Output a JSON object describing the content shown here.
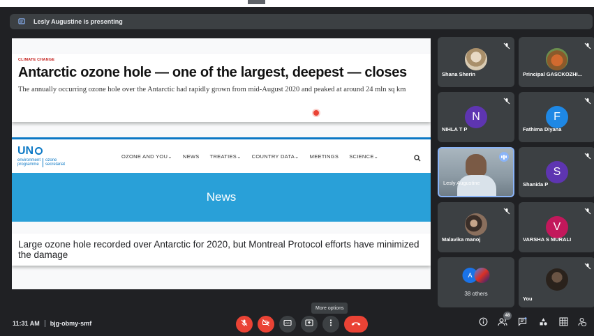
{
  "banner": {
    "presenting_text": "Lesly Augustine is presenting"
  },
  "presentation": {
    "kicker": "CLIMATE CHANGE",
    "headline": "Antarctic ozone hole — one of the largest, deepest — closes",
    "subhead": "The annually occurring ozone hole over the Antarctic had rapidly grown from mid-August 2020 and peaked at around 24 mln sq km",
    "logo": {
      "mark": "UN",
      "line1a": "environment",
      "line1b": "programme",
      "line2a": "ozone",
      "line2b": "secretariat"
    },
    "nav": [
      "OZONE AND YOU⌄",
      "NEWS",
      "TREATIES⌄",
      "COUNTRY DATA⌄",
      "MEETINGS",
      "SCIENCE⌄"
    ],
    "news_banner": "News",
    "story_title": "Large ozone hole recorded over Antarctic for 2020, but Montreal Protocol efforts have minimized the damage"
  },
  "participants": [
    {
      "name": "Shana Sherin",
      "type": "photo",
      "color": "#c9b99a",
      "muted": true
    },
    {
      "name": "Principal GASCKOZHI...",
      "type": "photo",
      "color": "#b86a3d",
      "muted": true
    },
    {
      "name": "NIHLA T P",
      "type": "initial",
      "initial": "N",
      "color": "#5e35b1",
      "muted": true
    },
    {
      "name": "Fathima Diyana",
      "type": "initial",
      "initial": "F",
      "color": "#1e88e5",
      "muted": true
    },
    {
      "name": "Lesly Augustine",
      "type": "video",
      "speaking": true
    },
    {
      "name": "Shanida P",
      "type": "initial",
      "initial": "S",
      "color": "#5e35b1",
      "muted": true
    },
    {
      "name": "Malavika manoj",
      "type": "photo",
      "color": "#6d5a4c",
      "muted": true
    },
    {
      "name": "VARSHA S MURALI",
      "type": "initial",
      "initial": "V",
      "color": "#c2185b",
      "muted": true
    },
    {
      "name": "38 others",
      "type": "others",
      "initial": "A"
    },
    {
      "name": "You",
      "type": "photo",
      "color": "#4a3b30",
      "muted": true
    }
  ],
  "tooltip": "More options",
  "meeting": {
    "time": "11:31 AM",
    "code": "bjg-obmy-smf"
  },
  "people_count": "48",
  "colors": {
    "red": "#ea4335",
    "accent": "#8ab4f8",
    "tile": "#3c4043",
    "background": "#202124"
  },
  "icons": [
    "mic-off-icon",
    "camera-off-icon",
    "captions-icon",
    "present-icon",
    "more-options-icon",
    "end-call-icon",
    "info-icon",
    "people-icon",
    "chat-icon",
    "activities-icon",
    "host-controls-icon"
  ]
}
